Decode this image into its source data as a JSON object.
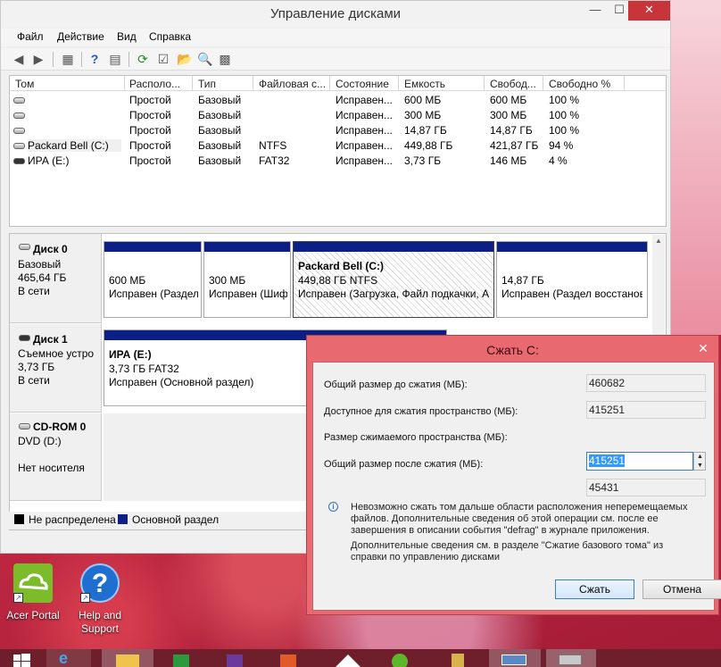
{
  "window": {
    "title": "Управление дисками",
    "minimize": "—",
    "maximize": "☐",
    "close": "✕"
  },
  "menu": [
    "Файл",
    "Действие",
    "Вид",
    "Справка"
  ],
  "volume_list": {
    "headers": [
      "Том",
      "Располо...",
      "Тип",
      "Файловая с...",
      "Состояние",
      "Емкость",
      "Свобод...",
      "Свободно %"
    ],
    "rows": [
      {
        "name": "",
        "layout": "Простой",
        "type": "Базовый",
        "fs": "",
        "status": "Исправен...",
        "capacity": "600 МБ",
        "free": "600 МБ",
        "free_pct": "100 %"
      },
      {
        "name": "",
        "layout": "Простой",
        "type": "Базовый",
        "fs": "",
        "status": "Исправен...",
        "capacity": "300 МБ",
        "free": "300 МБ",
        "free_pct": "100 %"
      },
      {
        "name": "",
        "layout": "Простой",
        "type": "Базовый",
        "fs": "",
        "status": "Исправен...",
        "capacity": "14,87 ГБ",
        "free": "14,87 ГБ",
        "free_pct": "100 %"
      },
      {
        "name": "Packard Bell (C:)",
        "layout": "Простой",
        "type": "Базовый",
        "fs": "NTFS",
        "status": "Исправен...",
        "capacity": "449,88 ГБ",
        "free": "421,87 ГБ",
        "free_pct": "94 %"
      },
      {
        "name": "ИРА (E:)",
        "layout": "Простой",
        "type": "Базовый",
        "fs": "FAT32",
        "status": "Исправен...",
        "capacity": "3,73 ГБ",
        "free": "146 МБ",
        "free_pct": "4 %"
      }
    ]
  },
  "disks": {
    "disk0": {
      "name": "Диск 0",
      "type": "Базовый",
      "size": "465,64 ГБ",
      "state": "В сети",
      "partitions": [
        {
          "title": "",
          "size": "600 МБ",
          "status": "Исправен (Раздел"
        },
        {
          "title": "",
          "size": "300 МБ",
          "status": "Исправен (Шиф"
        },
        {
          "title": "Packard Bell  (C:)",
          "size": "449,88 ГБ NTFS",
          "status": "Исправен (Загрузка, Файл подкачки, А"
        },
        {
          "title": "",
          "size": "14,87 ГБ",
          "status": "Исправен (Раздел восстанове"
        }
      ]
    },
    "disk1": {
      "name": "Диск 1",
      "type": "Съемное устро",
      "size": "3,73 ГБ",
      "state": "В сети",
      "partition": {
        "title": "ИРА  (E:)",
        "size": "3,73 ГБ FAT32",
        "status": "Исправен (Основной раздел)"
      }
    },
    "cdrom": {
      "name": "CD-ROM 0",
      "type": "DVD (D:)",
      "state": "Нет носителя"
    }
  },
  "legend": {
    "unallocated": "Не распределена",
    "primary": "Основной раздел",
    "unallocated_color": "#000000",
    "primary_color": "#0b1f87"
  },
  "dialog": {
    "title": "Сжать C:",
    "close": "✕",
    "total_before_label": "Общий размер до сжатия (МБ):",
    "total_before_value": "460682",
    "available_label": "Доступное для сжатия пространство (МБ):",
    "available_value": "415251",
    "shrink_label": "Размер сжимаемого пространства (МБ):",
    "shrink_value": "415251",
    "total_after_label": "Общий размер после сжатия (МБ):",
    "total_after_value": "45431",
    "info_text": "Невозможно сжать том дальше области расположения неперемещаемых файлов. Дополнительные сведения об этой операции см. после ее завершения в описании события \"defrag\" в журнале приложения.",
    "help_text": "Дополнительные сведения см. в разделе \"Сжатие базового тома\" из справки по управлению дисками",
    "shrink_button": "Сжать",
    "cancel_button": "Отмена",
    "accent_color": "#e8696f"
  },
  "desktop_icons": [
    {
      "label": "Acer Portal"
    },
    {
      "label": "Help and Support"
    }
  ]
}
